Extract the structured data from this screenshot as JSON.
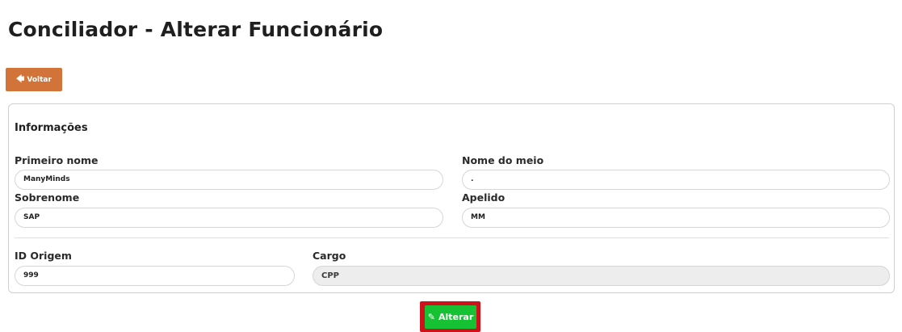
{
  "header": {
    "title": "Conciliador - Alterar Funcionário"
  },
  "toolbar": {
    "back_label": "Voltar",
    "back_icon": "arrow-left-icon"
  },
  "form": {
    "section_title": "Informações",
    "first_name": {
      "label": "Primeiro nome",
      "value": "ManyMinds"
    },
    "middle_name": {
      "label": "Nome do meio",
      "value": "."
    },
    "last_name": {
      "label": "Sobrenome",
      "value": "SAP"
    },
    "nickname": {
      "label": "Apelido",
      "value": "MM"
    },
    "origin_id": {
      "label": "ID Origem",
      "value": "999"
    },
    "position": {
      "label": "Cargo",
      "value": "CPP",
      "disabled": true
    }
  },
  "actions": {
    "submit_label": "Alterar",
    "submit_icon": "pencil-icon"
  },
  "colors": {
    "back_button": "#d2733a",
    "submit_button": "#16c233",
    "highlight": "#d0101a"
  }
}
